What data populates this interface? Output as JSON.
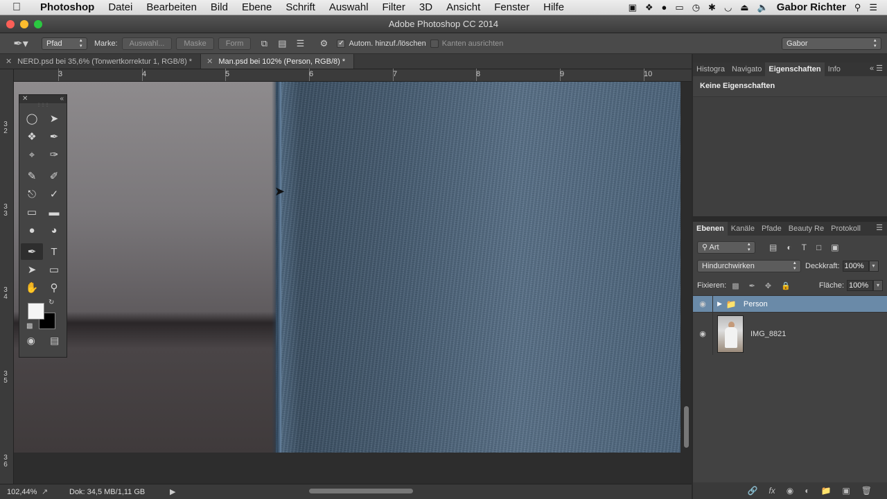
{
  "menubar": {
    "apple": "",
    "app_name": "Photoshop",
    "items": [
      "Datei",
      "Bearbeiten",
      "Bild",
      "Ebene",
      "Schrift",
      "Auswahl",
      "Filter",
      "3D",
      "Ansicht",
      "Fenster",
      "Hilfe"
    ],
    "user": "Gabor Richter"
  },
  "window": {
    "title": "Adobe Photoshop CC 2014"
  },
  "options": {
    "mode": "Pfad",
    "marke_label": "Marke:",
    "auswahl": "Auswahl...",
    "maske": "Maske",
    "form": "Form",
    "auto_add_delete": "Autom. hinzuf./löschen",
    "auto_add_delete_checked": true,
    "align_edges": "Kanten ausrichten",
    "align_edges_checked": false,
    "workspace": "Gabor"
  },
  "document_tabs": [
    {
      "label": "NERD.psd bei 35,6% (Tonwertkorrektur 1, RGB/8) *",
      "active": false
    },
    {
      "label": "Man.psd bei 102% (Person, RGB/8) *",
      "active": true
    }
  ],
  "rulers": {
    "top": [
      "3",
      "4",
      "5",
      "6",
      "7",
      "8",
      "9",
      "10"
    ],
    "left": [
      "3\n2",
      "3\n3",
      "3\n4",
      "3\n5",
      "3\n6"
    ]
  },
  "properties_panel": {
    "tabs": [
      "Histogra",
      "Navigato",
      "Eigenschaften",
      "Info"
    ],
    "active_tab": "Eigenschaften",
    "message": "Keine Eigenschaften"
  },
  "layers_panel": {
    "tabs": [
      "Ebenen",
      "Kanäle",
      "Pfade",
      "Beauty Re",
      "Protokoll"
    ],
    "active_tab": "Ebenen",
    "filter": "Art",
    "blend_mode": "Hindurchwirken",
    "opacity_label": "Deckkraft:",
    "opacity": "100%",
    "lock_label": "Fixieren:",
    "fill_label": "Fläche:",
    "fill": "100%",
    "layers": [
      {
        "name": "Person",
        "type": "group",
        "selected": true
      },
      {
        "name": "IMG_8821",
        "type": "smart-object",
        "selected": false
      }
    ]
  },
  "statusbar": {
    "zoom": "102,44%",
    "doc": "Dok: 34,5 MB/1,11 GB"
  },
  "colors": {
    "accent_selected_layer": "#6a8aa8",
    "foreground": "#f5f5f5",
    "background": "#000000"
  }
}
